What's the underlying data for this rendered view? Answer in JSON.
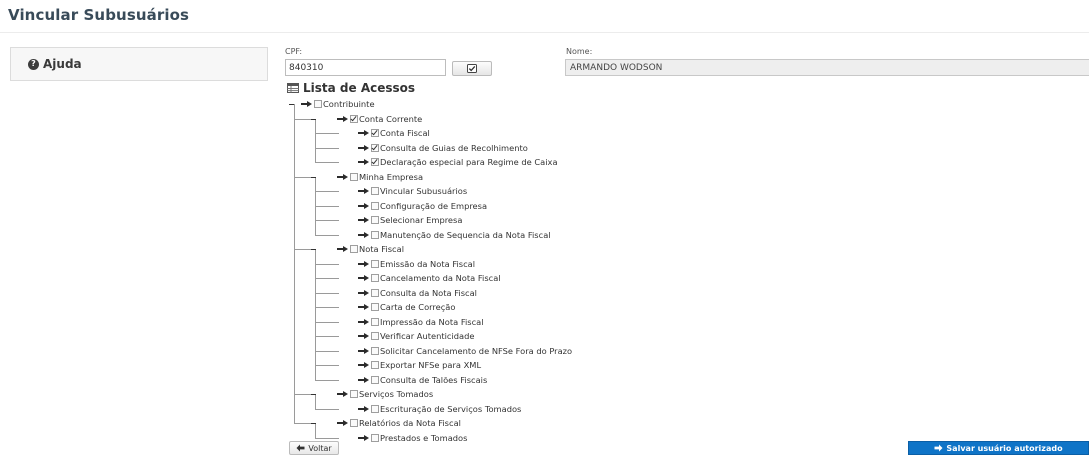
{
  "page": {
    "title": "Vincular Subusuários"
  },
  "help": {
    "label": "Ajuda"
  },
  "form": {
    "cpf_label": "CPF:",
    "cpf_value": "840310",
    "nome_label": "Nome:",
    "nome_value": "ARMANDO WODSON"
  },
  "list_title": "Lista de Acessos",
  "tree": [
    {
      "label": "Contribuinte",
      "level": 0,
      "checked": false,
      "expandable": true
    },
    {
      "label": "Conta Corrente",
      "level": 1,
      "checked": true,
      "expandable": true
    },
    {
      "label": "Conta Fiscal",
      "level": 2,
      "checked": true,
      "expandable": false
    },
    {
      "label": "Consulta de Guias de Recolhimento",
      "level": 2,
      "checked": true,
      "expandable": false
    },
    {
      "label": "Declaração especial para Regime de Caixa",
      "level": 2,
      "checked": true,
      "expandable": false
    },
    {
      "label": "Minha Empresa",
      "level": 1,
      "checked": false,
      "expandable": true
    },
    {
      "label": "Vincular Subusuários",
      "level": 2,
      "checked": false,
      "expandable": false
    },
    {
      "label": "Configuração de Empresa",
      "level": 2,
      "checked": false,
      "expandable": false
    },
    {
      "label": "Selecionar Empresa",
      "level": 2,
      "checked": false,
      "expandable": false
    },
    {
      "label": "Manutenção de Sequencia da Nota Fiscal",
      "level": 2,
      "checked": false,
      "expandable": false
    },
    {
      "label": "Nota Fiscal",
      "level": 1,
      "checked": false,
      "expandable": true
    },
    {
      "label": "Emissão da Nota Fiscal",
      "level": 2,
      "checked": false,
      "expandable": false
    },
    {
      "label": "Cancelamento da Nota Fiscal",
      "level": 2,
      "checked": false,
      "expandable": false
    },
    {
      "label": "Consulta da Nota Fiscal",
      "level": 2,
      "checked": false,
      "expandable": false
    },
    {
      "label": "Carta de Correção",
      "level": 2,
      "checked": false,
      "expandable": false
    },
    {
      "label": "Impressão da Nota Fiscal",
      "level": 2,
      "checked": false,
      "expandable": false
    },
    {
      "label": "Verificar Autenticidade",
      "level": 2,
      "checked": false,
      "expandable": false
    },
    {
      "label": "Solicitar Cancelamento de NFSe Fora do Prazo",
      "level": 2,
      "checked": false,
      "expandable": false
    },
    {
      "label": "Exportar NFSe para XML",
      "level": 2,
      "checked": false,
      "expandable": false
    },
    {
      "label": "Consulta de Talões Fiscais",
      "level": 2,
      "checked": false,
      "expandable": false
    },
    {
      "label": "Serviços Tomados",
      "level": 1,
      "checked": false,
      "expandable": true
    },
    {
      "label": "Escrituração de Serviços Tomados",
      "level": 2,
      "checked": false,
      "expandable": false
    },
    {
      "label": "Relatórios da Nota Fiscal",
      "level": 1,
      "checked": false,
      "expandable": true
    },
    {
      "label": "Prestados e Tomados",
      "level": 2,
      "checked": false,
      "expandable": false
    }
  ],
  "buttons": {
    "back_label": "Voltar",
    "save_label": "Salvar usuário autorizado"
  },
  "colors": {
    "primary": "#0f74c7",
    "title": "#394b59"
  },
  "icons": {
    "help": "question-circle-icon",
    "verify": "check-square-icon",
    "list": "list-table-icon",
    "node": "hand-pointer-icon",
    "back": "arrow-left-icon",
    "save": "arrow-right-icon"
  }
}
